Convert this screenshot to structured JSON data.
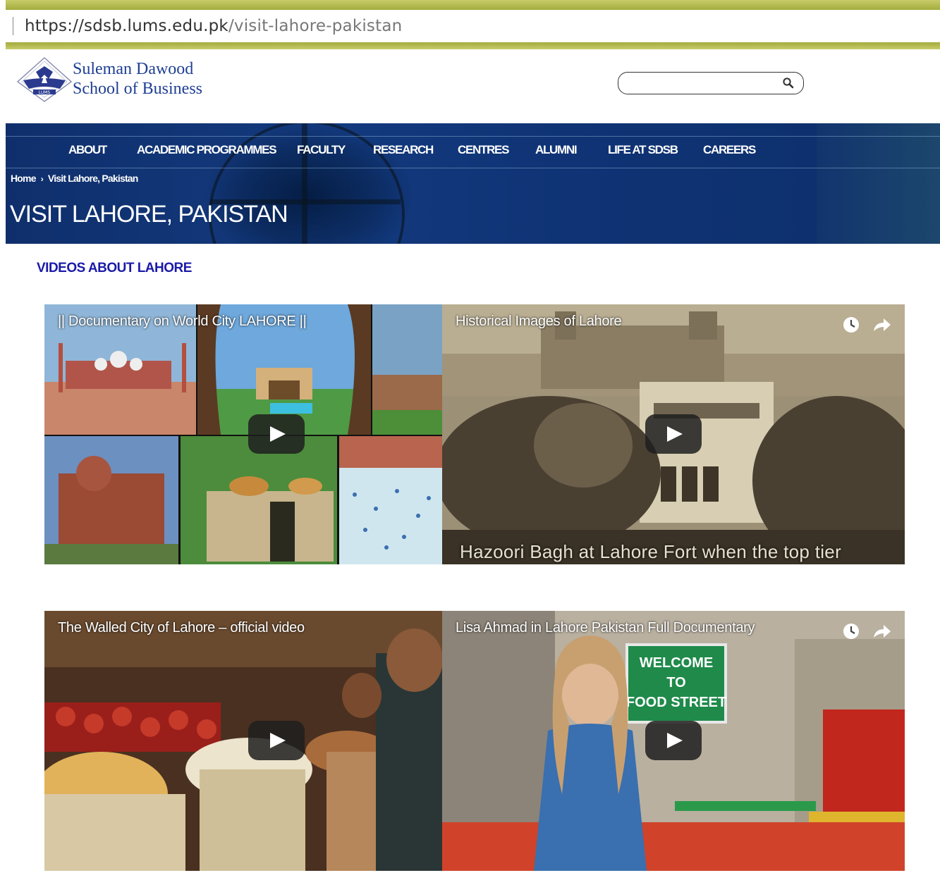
{
  "browser": {
    "url_host": "https://sdsb.lums.edu.pk",
    "url_path": "/visit-lahore-pakistan"
  },
  "header": {
    "brand_line1": "Suleman Dawood",
    "brand_line2": "School of Business",
    "logo_text": "LUMS",
    "search_placeholder": ""
  },
  "nav": [
    "ABOUT",
    "ACADEMIC PROGRAMMES",
    "FACULTY",
    "RESEARCH",
    "CENTRES",
    "ALUMNI",
    "LIFE AT SDSB",
    "CAREERS"
  ],
  "breadcrumb": {
    "home": "Home",
    "separator": "›",
    "current": "Visit Lahore, Pakistan"
  },
  "page_title": "VISIT LAHORE, PAKISTAN",
  "section_heading": "VIDEOS ABOUT LAHORE",
  "videos": [
    {
      "title": "|| Documentary on World City LAHORE ||"
    },
    {
      "title": "Historical Images of Lahore",
      "caption": "Hazoori Bagh at Lahore Fort when the top tier"
    },
    {
      "title": "The Walled City of Lahore – official video"
    },
    {
      "title": "Lisa Ahmad in Lahore Pakistan Full Documentary",
      "sign_text": "WELCOME TO FOOD STREET"
    }
  ],
  "colors": {
    "nav_blue": "#133a7e",
    "section_heading": "#1a1aa8",
    "brand": "#1f3f93",
    "browser_stripe": "#a3ab3c"
  }
}
